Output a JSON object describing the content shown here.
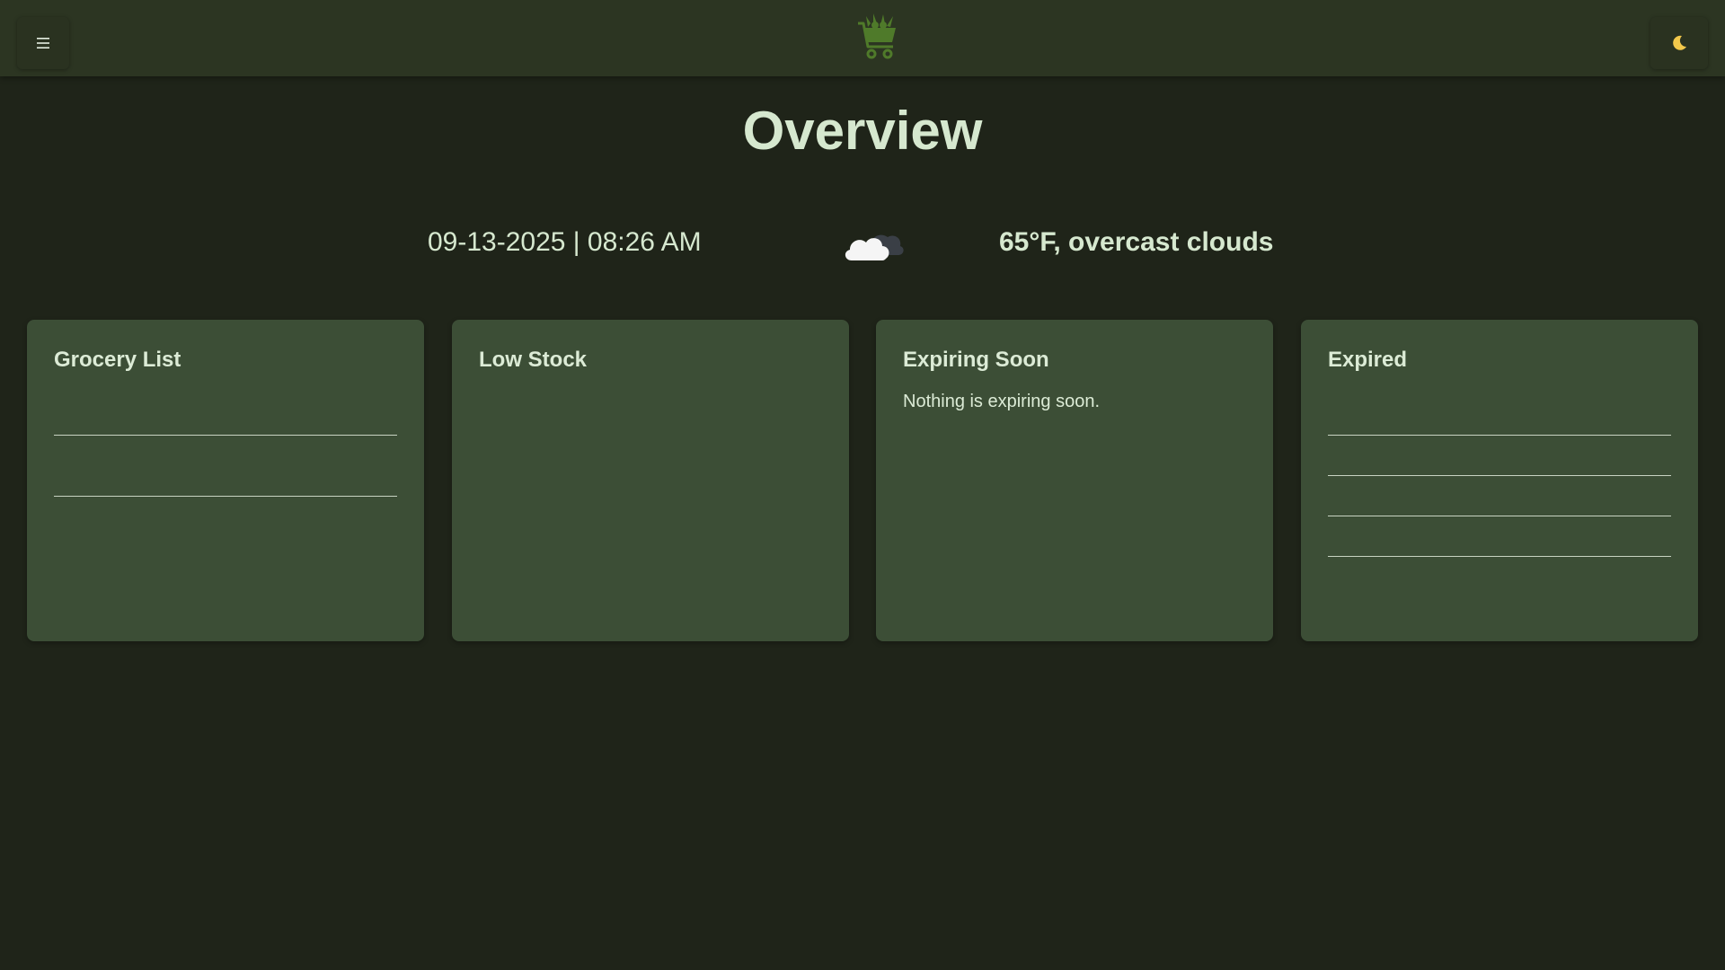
{
  "header": {
    "menu_icon": "hamburger-menu-icon",
    "logo_icon": "grocery-cart-icon",
    "theme_icon": "moon-icon"
  },
  "page": {
    "title": "Overview"
  },
  "info": {
    "datetime": "09-13-2025 | 08:26 AM",
    "weather_icon": "cloud-icon",
    "weather": "65°F, overcast clouds"
  },
  "cards": {
    "grocery": {
      "title": "Grocery List"
    },
    "low_stock": {
      "title": "Low Stock"
    },
    "expiring": {
      "title": "Expiring Soon",
      "message": "Nothing is expiring soon."
    },
    "expired": {
      "title": "Expired"
    }
  },
  "colors": {
    "background": "#1f2419",
    "header": "#2c3522",
    "card": "#3c4e36",
    "text": "#d6e8cf",
    "accent_green": "#4f7a2a"
  }
}
